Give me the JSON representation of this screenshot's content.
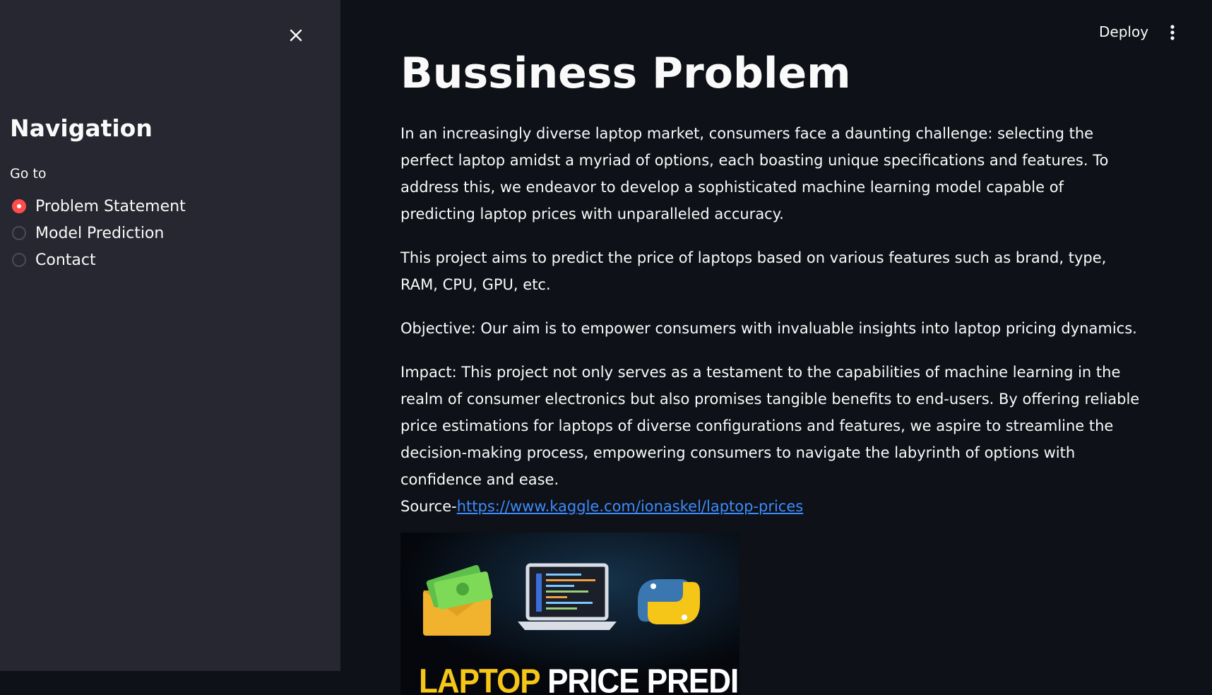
{
  "sidebar": {
    "title": "Navigation",
    "radio_label": "Go to",
    "options": [
      {
        "label": "Problem Statement",
        "checked": true
      },
      {
        "label": "Model Prediction",
        "checked": false
      },
      {
        "label": "Contact",
        "checked": false
      }
    ],
    "accent_color": "#ff4b4b"
  },
  "header": {
    "deploy_label": "Deploy"
  },
  "main": {
    "title": "Bussiness Problem",
    "paragraphs": [
      "In an increasingly diverse laptop market, consumers face a daunting challenge: selecting the perfect laptop amidst a myriad of options, each boasting unique specifications and features. To address this, we endeavor to develop a sophisticated machine learning model capable of predicting laptop prices with unparalleled accuracy.",
      "This project aims to predict the price of laptops based on various features such as brand, type, RAM, CPU, GPU, etc.",
      "Objective: Our aim is to empower consumers with invaluable insights into laptop pricing dynamics.",
      "Impact: This project not only serves as a testament to the capabilities of machine learning in the realm of consumer electronics but also promises tangible benefits to end-users. By offering reliable price estimations for laptops of diverse configurations and features, we aspire to streamline the decision-making process, empowering consumers to navigate the labyrinth of options with confidence and ease."
    ],
    "source_prefix": "Source-",
    "source_link": "https://www.kaggle.com/ionaskel/laptop-prices",
    "banner": {
      "highlight": "LAPTOP",
      "rest": " PRICE PREDICTION"
    }
  }
}
